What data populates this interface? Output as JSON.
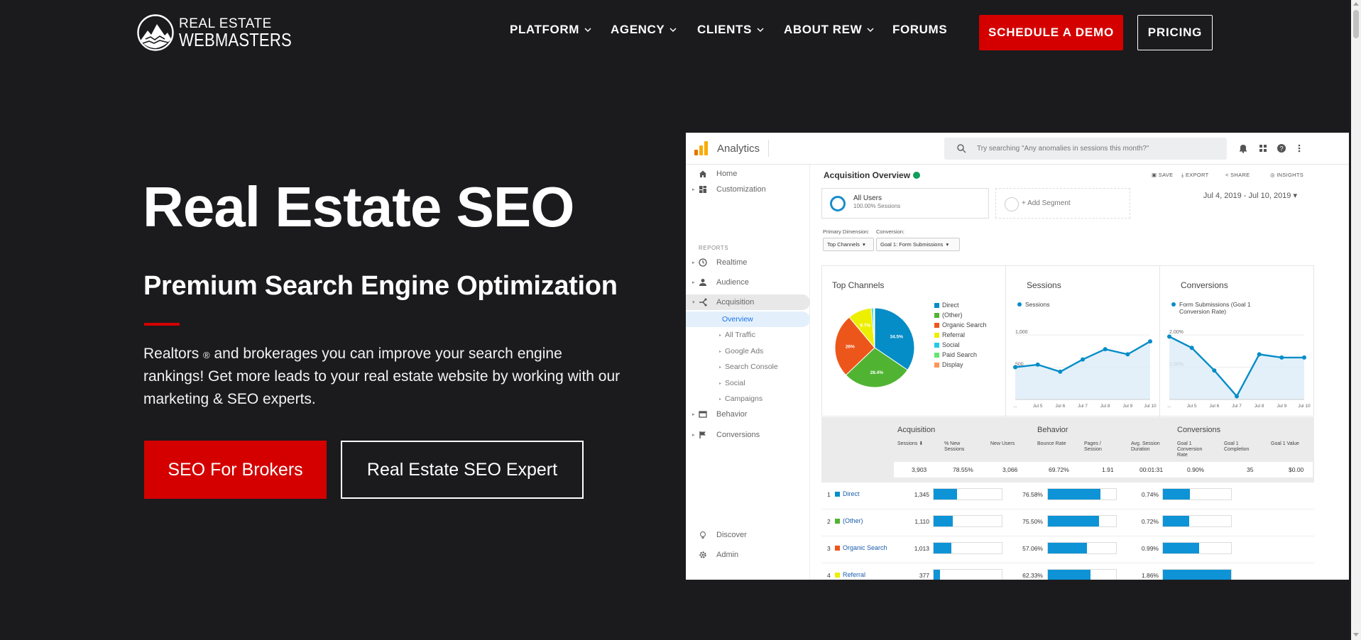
{
  "header": {
    "logo_line1": "REAL ESTATE",
    "logo_line2": "WEBMASTERS",
    "nav": [
      {
        "label": "PLATFORM",
        "dropdown": true
      },
      {
        "label": "AGENCY",
        "dropdown": true
      },
      {
        "label": "CLIENTS",
        "dropdown": true
      },
      {
        "label": "ABOUT REW",
        "dropdown": true
      },
      {
        "label": "FORUMS",
        "dropdown": false
      }
    ],
    "demo_label": "SCHEDULE A DEMO",
    "pricing_label": "PRICING"
  },
  "hero": {
    "title": "Real Estate SEO",
    "subtitle": "Premium Search Engine Optimization",
    "body_pre": "Realtors ",
    "body_sup": "®",
    "body_post": " and brokerages you can improve your search engine rankings! Get more leads to your real estate website by working with our marketing & SEO experts.",
    "btn_primary": "SEO For Brokers",
    "btn_secondary": "Real Estate SEO Expert"
  },
  "analytics": {
    "app_title": "Analytics",
    "search_placeholder": "Try searching \"Any anomalies in sessions this month?\"",
    "sidebar": {
      "home": "Home",
      "customization": "Customization",
      "reports_label": "REPORTS",
      "realtime": "Realtime",
      "audience": "Audience",
      "acquisition": "Acquisition",
      "overview": "Overview",
      "subs": [
        "All Traffic",
        "Google Ads",
        "Search Console",
        "Social",
        "Campaigns"
      ],
      "behavior": "Behavior",
      "conversions": "Conversions",
      "discover": "Discover",
      "admin": "Admin"
    },
    "page_title": "Acquisition Overview",
    "tools": [
      "SAVE",
      "EXPORT",
      "SHARE",
      "INSIGHTS"
    ],
    "segment": {
      "name": "All Users",
      "detail": "100.00% Sessions",
      "add": "+ Add Segment"
    },
    "date_range": "Jul 4, 2019 - Jul 10, 2019",
    "primary_dimension_label": "Primary Dimension:",
    "primary_dimension_value": "Top Channels",
    "conversion_label": "Conversion:",
    "conversion_value": "Goal 1: Form Submissions",
    "cards": {
      "top_channels": "Top Channels",
      "sessions": "Sessions",
      "conversions": "Conversions"
    },
    "table": {
      "groups": [
        "Acquisition",
        "Behavior",
        "Conversions"
      ],
      "columns": [
        "Sessions",
        "% New Sessions",
        "New Users",
        "Bounce Rate",
        "Pages / Session",
        "Avg. Session Duration",
        "Goal 1 Conversion Rate",
        "Goal 1 Completion",
        "Goal 1 Value"
      ],
      "totals": [
        "3,903",
        "78.55%",
        "3,066",
        "69.72%",
        "1.91",
        "00:01:31",
        "0.90%",
        "35",
        "$0.00"
      ],
      "rows": [
        {
          "n": "1",
          "channel": "Direct",
          "color": "#058dc7",
          "sessions": "1,345",
          "sessions_share": 0.345,
          "bounce": "76.58%",
          "bounce_share": 0.766,
          "conv": "0.74%",
          "conv_share": 0.4
        },
        {
          "n": "2",
          "channel": "(Other)",
          "color": "#50b432",
          "sessions": "1,110",
          "sessions_share": 0.284,
          "bounce": "75.50%",
          "bounce_share": 0.755,
          "conv": "0.72%",
          "conv_share": 0.39
        },
        {
          "n": "3",
          "channel": "Organic Search",
          "color": "#ed561b",
          "sessions": "1,013",
          "sessions_share": 0.26,
          "bounce": "57.06%",
          "bounce_share": 0.57,
          "conv": "0.99%",
          "conv_share": 0.53
        },
        {
          "n": "4",
          "channel": "Referral",
          "color": "#edef00",
          "sessions": "377",
          "sessions_share": 0.097,
          "bounce": "62.33%",
          "bounce_share": 0.62,
          "conv": "1.86%",
          "conv_share": 1.0
        }
      ]
    }
  },
  "chart_data": [
    {
      "type": "pie",
      "title": "Top Channels",
      "categories": [
        "Direct",
        "(Other)",
        "Organic Search",
        "Referral",
        "Social",
        "Paid Search",
        "Display"
      ],
      "values": [
        34.5,
        28.4,
        26.0,
        9.7,
        0.8,
        0.4,
        0.2
      ],
      "labels_shown": [
        "34.5%",
        "28.4%",
        "26%",
        "9.7%"
      ],
      "colors": [
        "#058dc7",
        "#50b432",
        "#ed561b",
        "#edef00",
        "#24cbe5",
        "#64e572",
        "#ff9655"
      ],
      "legend": "right"
    },
    {
      "type": "line",
      "title": "Sessions",
      "series": [
        {
          "name": "Sessions",
          "values": [
            500,
            540,
            430,
            620,
            780,
            700,
            900
          ]
        }
      ],
      "categories": [
        "...",
        "Jul 5",
        "Jul 6",
        "Jul 7",
        "Jul 8",
        "Jul 9",
        "Jul 10"
      ],
      "yticks": [
        "1,000",
        "500"
      ],
      "ylim": [
        0,
        1100
      ]
    },
    {
      "type": "line",
      "title": "Conversions",
      "series": [
        {
          "name": "Form Submissions (Goal 1 Conversion Rate)",
          "values": [
            1.95,
            1.6,
            0.9,
            0.1,
            1.4,
            1.3,
            1.3
          ]
        }
      ],
      "categories": [
        "...",
        "Jul 5",
        "Jul 6",
        "Jul 7",
        "Jul 8",
        "Jul 9",
        "Jul 10"
      ],
      "yticks": [
        "2.00%",
        "1.00%"
      ],
      "ylim": [
        0,
        2.2
      ]
    }
  ]
}
